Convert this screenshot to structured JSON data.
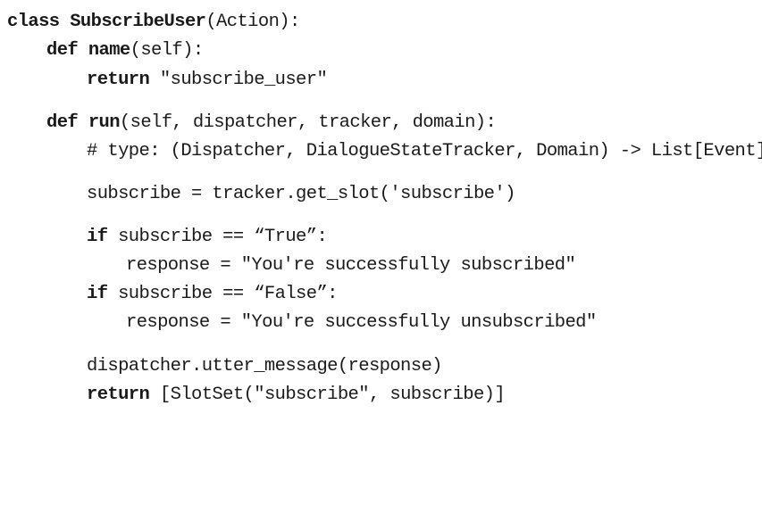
{
  "code": {
    "line1": {
      "kw": "class",
      "space": " ",
      "name": "SubscribeUser",
      "rest": "(Action):"
    },
    "line2": {
      "kw": "def",
      "space": " ",
      "name": "name",
      "rest": "(self):"
    },
    "line3": {
      "kw": "return",
      "rest": " \"subscribe_user\""
    },
    "line4": {
      "kw": "def",
      "space": " ",
      "name": "run",
      "rest": "(self, dispatcher, tracker, domain):"
    },
    "line5": {
      "text": "# type: (Dispatcher, DialogueStateTracker, Domain) -> List[Event]"
    },
    "line6": {
      "text": "subscribe = tracker.get_slot('subscribe')"
    },
    "line7": {
      "kw": "if",
      "rest": " subscribe == “True”:"
    },
    "line8": {
      "text": "response = \"You're successfully subscribed\""
    },
    "line9": {
      "kw": "if",
      "rest": " subscribe == “False”:"
    },
    "line10": {
      "text": "response = \"You're successfully unsubscribed\""
    },
    "line11": {
      "text": "dispatcher.utter_message(response)"
    },
    "line12": {
      "kw": "return",
      "rest": " [SlotSet(\"subscribe\", subscribe)]"
    }
  }
}
